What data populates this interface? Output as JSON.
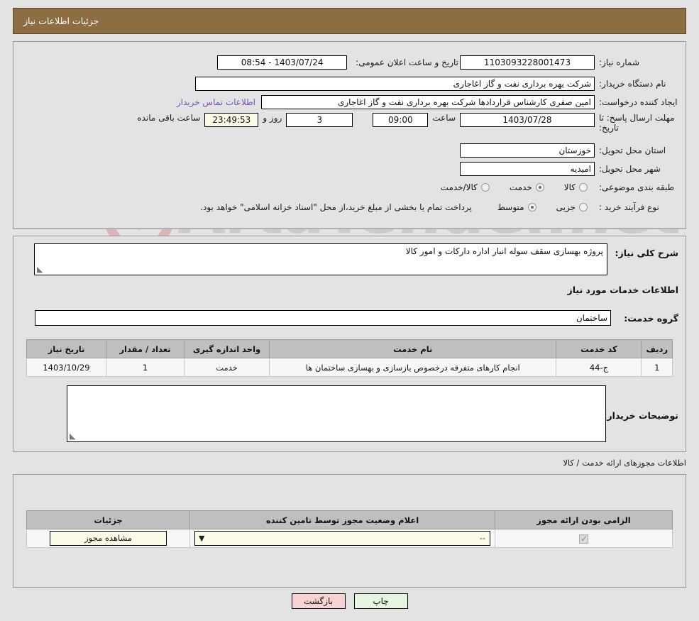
{
  "header": {
    "title": "جزئیات اطلاعات نیاز"
  },
  "form": {
    "need_number_label": "شماره نیاز:",
    "need_number_value": "1103093228001473",
    "announce_label": "تاریخ و ساعت اعلان عمومی:",
    "announce_value": "1403/07/24 - 08:54",
    "buyer_org_label": "نام دستگاه خریدار:",
    "buyer_org_value": "شرکت بهره برداری نفت و گاز اغاجاری",
    "creator_label": "ایجاد کننده درخواست:",
    "creator_value": "امین صفری کارشناس قراردادها شرکت بهره برداری نفت و گاز اغاجاری",
    "contact_link": "اطلاعات تماس خریدار",
    "deadline_label": "مهلت ارسال پاسخ: تا تاریخ:",
    "deadline_date": "1403/07/28",
    "hour_label": "ساعت",
    "deadline_time": "09:00",
    "days_value": "3",
    "days_label": "روز و",
    "countdown_value": "23:49:53",
    "countdown_label": "ساعت باقی مانده",
    "province_label": "استان محل تحویل:",
    "province_value": "خوزستان",
    "city_label": "شهر محل تحویل:",
    "city_value": "امیدیه",
    "category_label": "طبقه بندی موضوعی:",
    "category_options": [
      {
        "label": "کالا",
        "selected": false
      },
      {
        "label": "خدمت",
        "selected": true
      },
      {
        "label": "کالا/خدمت",
        "selected": false
      }
    ],
    "process_label": "نوع فرآیند خرید :",
    "process_options": [
      {
        "label": "جزیی",
        "selected": false
      },
      {
        "label": "متوسط",
        "selected": true
      }
    ],
    "payment_note": "پرداخت تمام یا بخشی از مبلغ خرید،از محل \"اسناد خزانه اسلامی\" خواهد بود."
  },
  "description": {
    "label": "شرح کلی نیاز:",
    "value": "پروژه بهسازی سقف سوله انبار اداره دارکات و امور کالا"
  },
  "services": {
    "section_title": "اطلاعات خدمات مورد نیاز",
    "group_label": "گروه خدمت:",
    "group_value": "ساختمان",
    "columns": [
      "ردیف",
      "کد خدمت",
      "نام خدمت",
      "واحد اندازه گیری",
      "تعداد / مقدار",
      "تاریخ نیاز"
    ],
    "rows": [
      {
        "row": "1",
        "code": "ج-44",
        "name": "انجام کارهای متفرقه درخصوص بازسازی و بهسازی ساختمان ها",
        "unit": "خدمت",
        "quantity": "1",
        "date": "1403/10/29"
      }
    ]
  },
  "buyer_notes": {
    "label": "توضیحات خریدار:",
    "value": ""
  },
  "permits": {
    "section_title": "اطلاعات مجوزهای ارائه خدمت / کالا",
    "columns": [
      "الزامی بودن ارائه مجوز",
      "اعلام وضعیت مجوز توسط تامین کننده",
      "جزئیات"
    ],
    "rows": [
      {
        "required": true,
        "status_value": "--",
        "details_label": "مشاهده مجوز"
      }
    ]
  },
  "footer": {
    "print_label": "چاپ",
    "back_label": "بازگشت"
  },
  "watermark": {
    "brand": "ArtaTend",
    "tld": "er.net"
  },
  "colors": {
    "header_bg": "#8d6e43",
    "page_bg": "#e3e3e3",
    "link": "#7b4fbf",
    "back_btn": "#f9d3d3",
    "print_btn": "#e5f5e0",
    "cream": "#fbfbe8"
  }
}
